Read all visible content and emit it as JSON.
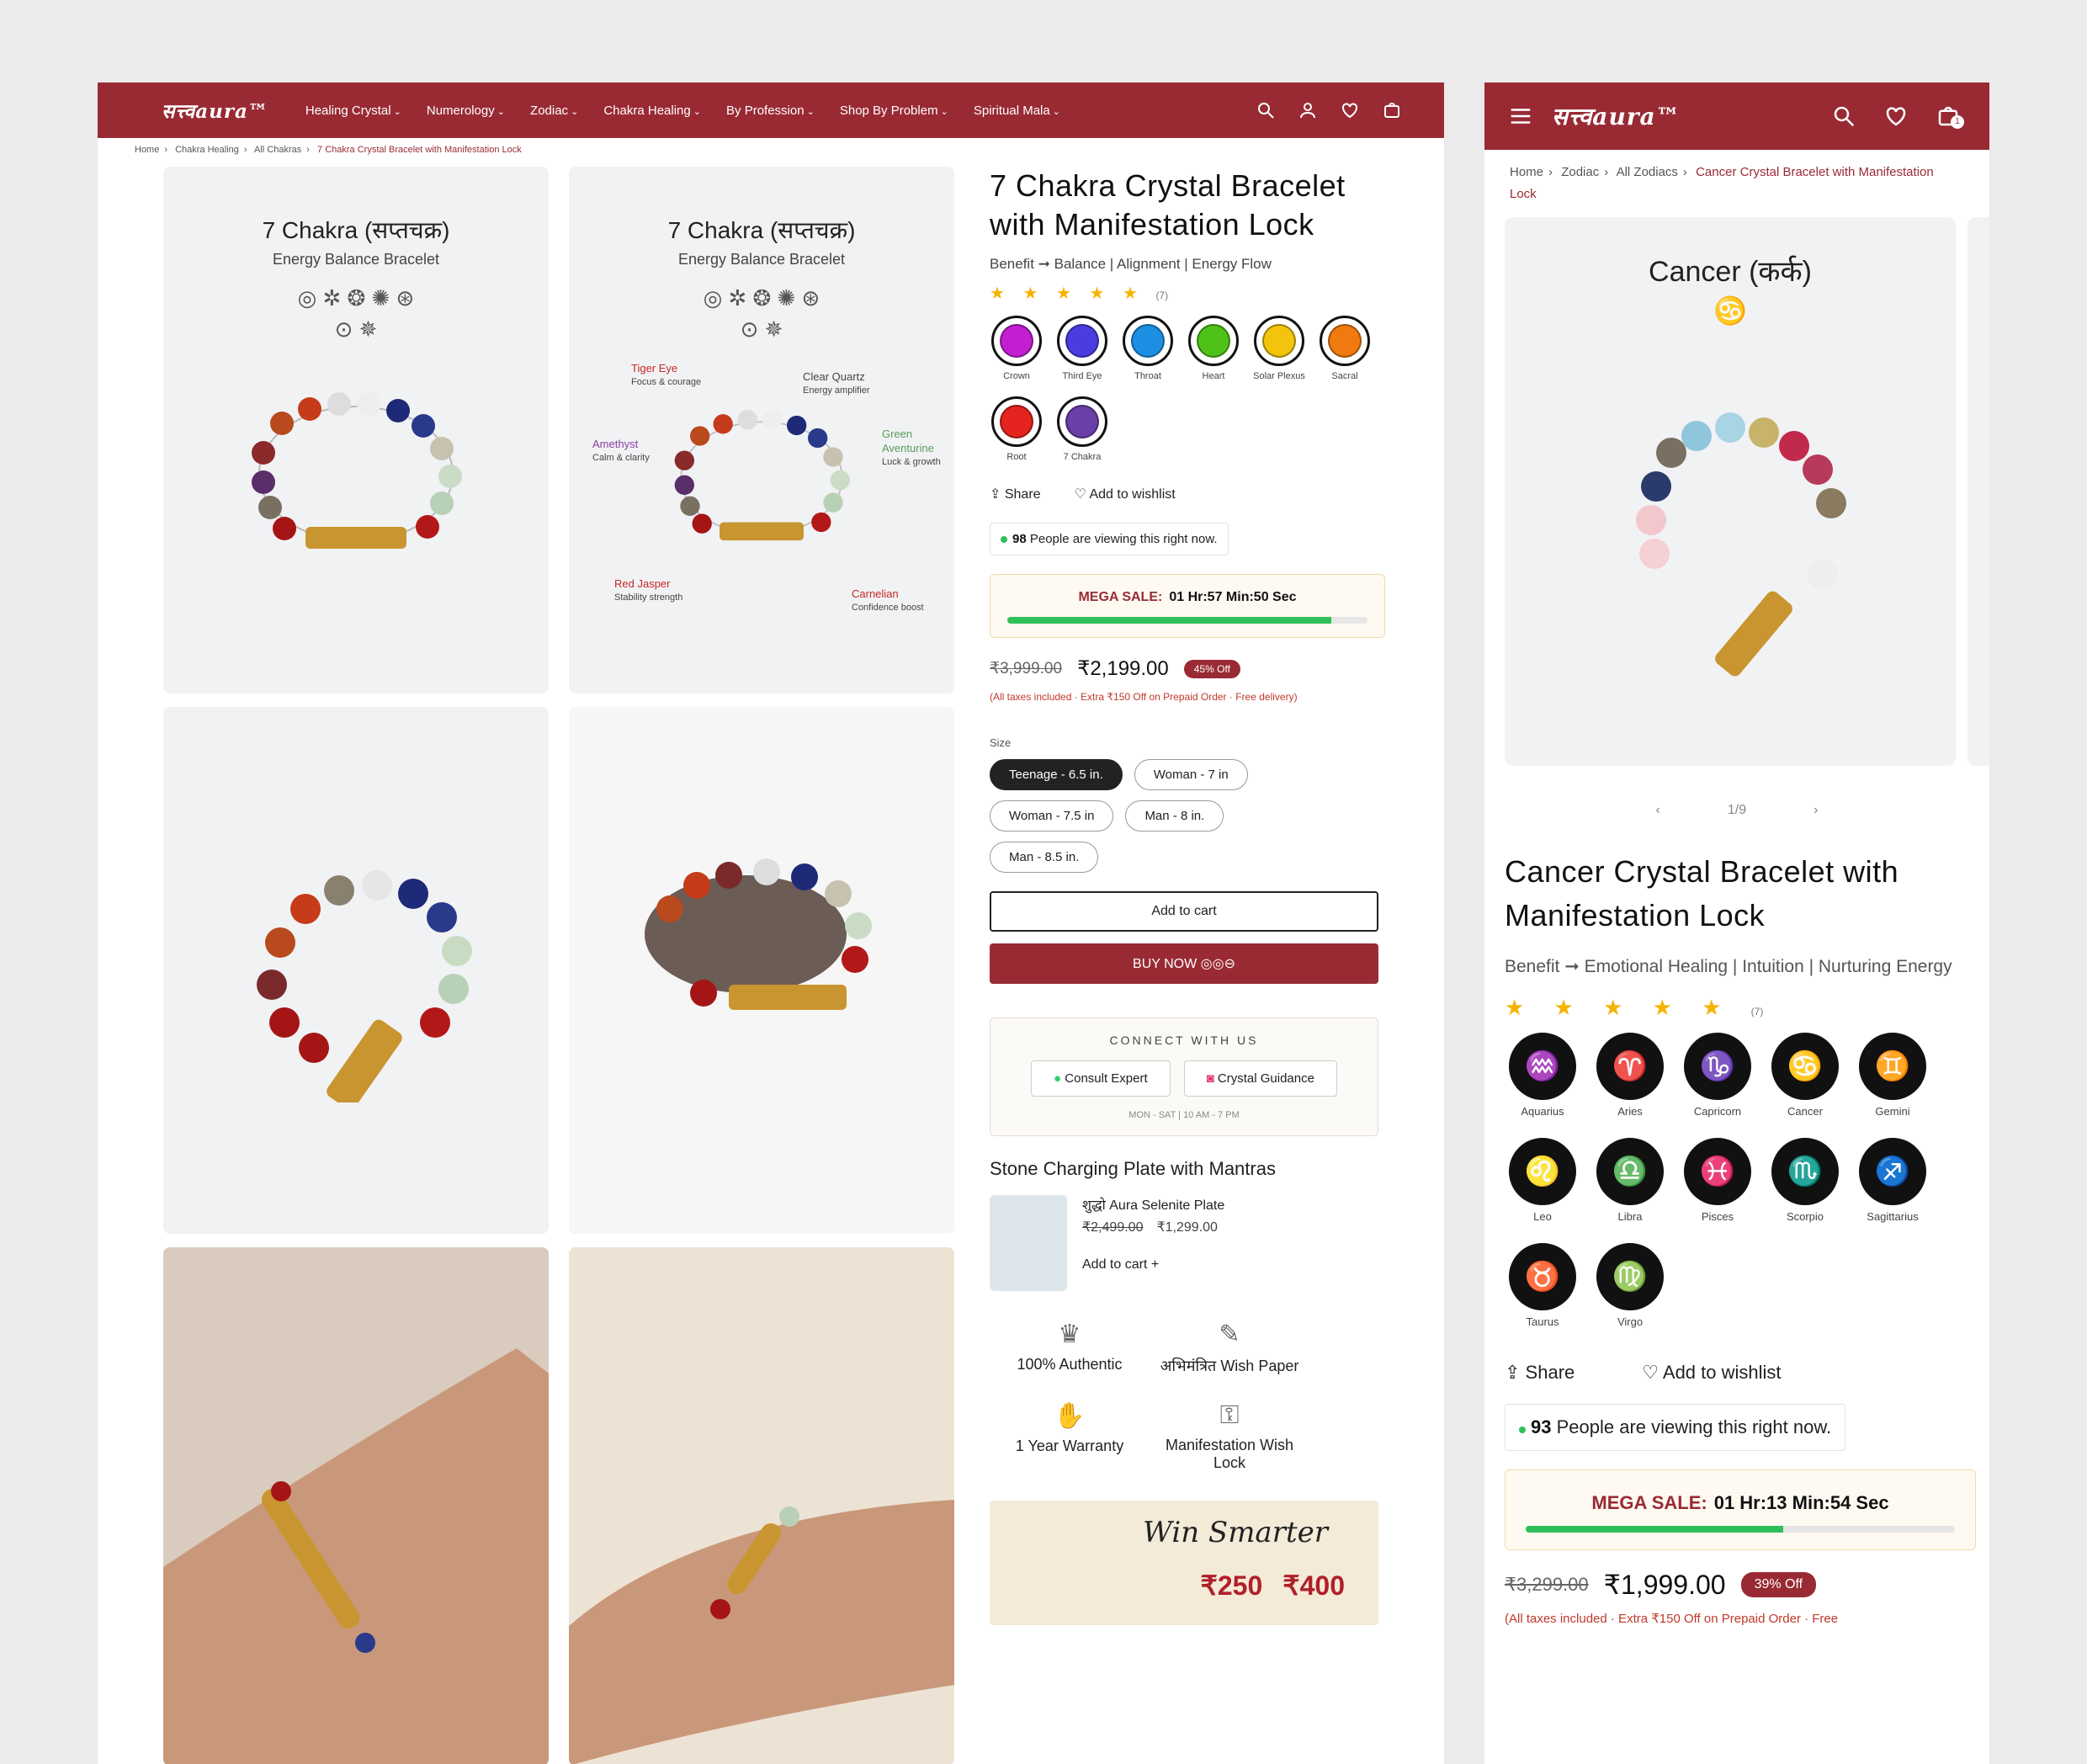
{
  "desktop": {
    "logo": "सत्त्वaura™",
    "nav": [
      "Healing Crystal",
      "Numerology",
      "Zodiac",
      "Chakra Healing",
      "By Profession",
      "Shop By Problem",
      "Spiritual Mala"
    ],
    "breadcrumb": [
      "Home",
      "Chakra Healing",
      "All Chakras",
      "7 Chakra Crystal Bracelet with Manifestation Lock"
    ],
    "tile1": {
      "title": "7 Chakra (सप्तचक्र)",
      "subtitle": "Energy Balance Bracelet"
    },
    "tile2": {
      "title": "7 Chakra (सप्तचक्र)",
      "subtitle": "Energy Balance Bracelet",
      "callouts": [
        {
          "name": "Tiger Eye",
          "desc": "Focus & courage"
        },
        {
          "name": "Clear Quartz",
          "desc": "Energy amplifier"
        },
        {
          "name": "Amethyst",
          "desc": "Calm & clarity"
        },
        {
          "name": "Green Aventurine",
          "desc": "Luck & growth"
        },
        {
          "name": "Red Jasper",
          "desc": "Stability strength"
        },
        {
          "name": "Carnelian",
          "desc": "Confidence boost"
        }
      ]
    },
    "product": {
      "title": "7 Chakra Crystal Bracelet with Manifestation Lock",
      "benefit": "Benefit ➞ Balance | Alignment | Energy Flow",
      "stars": "★ ★ ★ ★ ★",
      "rating_count": "(7)",
      "swatches": [
        {
          "label": "Crown",
          "color": "#c21fd1"
        },
        {
          "label": "Third Eye",
          "color": "#4a3de0"
        },
        {
          "label": "Throat",
          "color": "#1c8fe3"
        },
        {
          "label": "Heart",
          "color": "#4fc21a"
        },
        {
          "label": "Solar Plexus",
          "color": "#f2c40c"
        },
        {
          "label": "Sacral",
          "color": "#f07a10"
        },
        {
          "label": "Root",
          "color": "#e5241f"
        },
        {
          "label": "7 Chakra",
          "color": "#6a3fa8"
        }
      ],
      "share": "Share",
      "wishlist": "Add to wishlist",
      "viewers_count": "98",
      "viewers_text": "People are viewing this right now.",
      "sale_label": "MEGA SALE:",
      "sale_timer": "01 Hr:57 Min:50 Sec",
      "sale_progress": 0.9,
      "old_price": "₹3,999.00",
      "new_price": "₹2,199.00",
      "discount": "45% Off",
      "tax_note": "(All taxes included · Extra ₹150 Off on Prepaid Order · Free delivery)",
      "size_label": "Size",
      "sizes": [
        "Teenage - 6.5 in.",
        "Woman - 7 in",
        "Woman - 7.5 in",
        "Man - 8 in.",
        "Man - 8.5 in."
      ],
      "add_to_cart": "Add to cart",
      "buy_now": "BUY NOW",
      "connect_title": "CONNECT WITH US",
      "consult": "Consult Expert",
      "guidance": "Crystal Guidance",
      "hours": "MON - SAT | 10 AM - 7 PM",
      "stone_heading": "Stone Charging Plate with Mantras",
      "plate_name": "शुद्धो Aura Selenite Plate",
      "plate_old": "₹2,499.00",
      "plate_new": "₹1,299.00",
      "plate_add": "Add to cart  +",
      "features": [
        "100% Authentic",
        "अभिमंत्रित Wish Paper",
        "1 Year Warranty",
        "Manifestation Wish Lock"
      ],
      "banner_script": "Win Smarter",
      "banner_offer1": "₹250",
      "banner_offer2": "₹400"
    }
  },
  "mobile": {
    "logo": "सत्त्वaura™",
    "cart_count": "1",
    "breadcrumb": [
      "Home",
      "Zodiac",
      "All Zodiacs",
      "Cancer Crystal Bracelet with Manifestation Lock"
    ],
    "image_title": "Cancer (कर्क)",
    "image_glyph": "♋",
    "pager": "1/9",
    "product": {
      "title": "Cancer Crystal Bracelet with Manifestation Lock",
      "benefit": "Benefit ➞ Emotional Healing | Intuition | Nurturing Energy",
      "stars": "★ ★ ★ ★ ★",
      "rating_count": "(7)",
      "zodiacs": [
        {
          "label": "Aquarius",
          "glyph": "♒"
        },
        {
          "label": "Aries",
          "glyph": "♈"
        },
        {
          "label": "Capricorn",
          "glyph": "♑"
        },
        {
          "label": "Cancer",
          "glyph": "♋"
        },
        {
          "label": "Gemini",
          "glyph": "♊"
        },
        {
          "label": "Leo",
          "glyph": "♌"
        },
        {
          "label": "Libra",
          "glyph": "♎"
        },
        {
          "label": "Pisces",
          "glyph": "♓"
        },
        {
          "label": "Scorpio",
          "glyph": "♏"
        },
        {
          "label": "Sagittarius",
          "glyph": "♐"
        },
        {
          "label": "Taurus",
          "glyph": "♉"
        },
        {
          "label": "Virgo",
          "glyph": "♍"
        }
      ],
      "share": "Share",
      "wishlist": "Add to wishlist",
      "viewers_count": "93",
      "viewers_text": "People are viewing this right now.",
      "sale_label": "MEGA SALE:",
      "sale_timer": "01 Hr:13 Min:54 Sec",
      "sale_progress": 0.6,
      "old_price": "₹3,299.00",
      "new_price": "₹1,999.00",
      "discount": "39% Off",
      "tax_note": "(All taxes included · Extra ₹150 Off on Prepaid Order · Free"
    }
  }
}
